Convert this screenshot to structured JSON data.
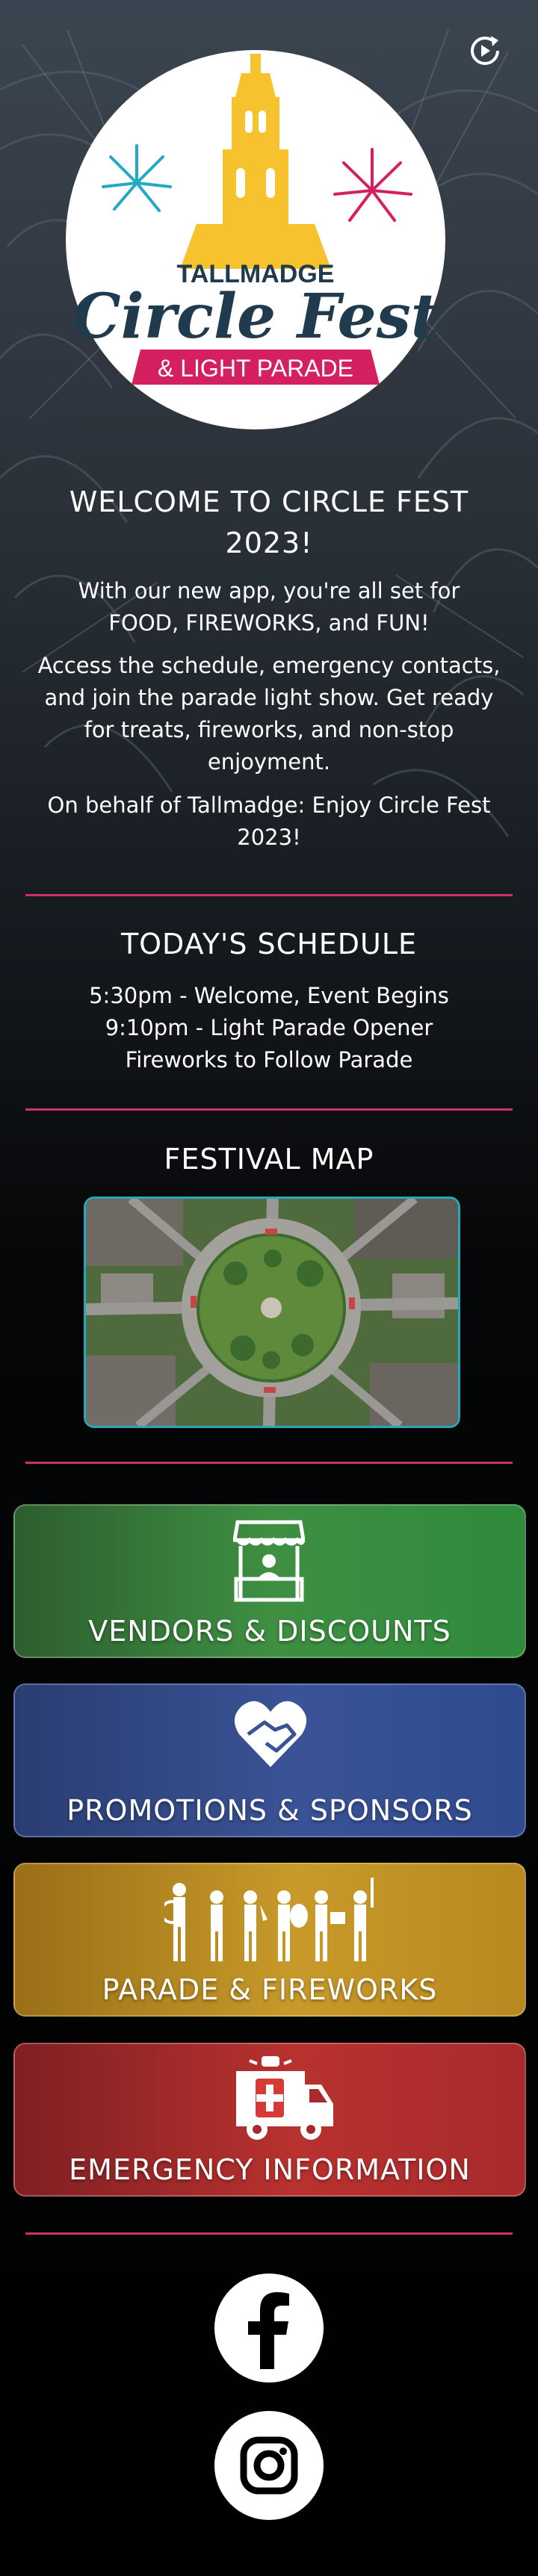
{
  "logo": {
    "top_text": "TALLMADGE",
    "main_text": "Circle Fest",
    "banner_text": "& LIGHT PARADE",
    "colors": {
      "gold": "#f6c22d",
      "navy": "#1f3b4d",
      "magenta": "#d4205f",
      "teal": "#21a9c6"
    }
  },
  "welcome": {
    "title_line1": "WELCOME TO CIRCLE FEST",
    "title_line2": "2023!",
    "p1_line1": "With our new app, you're all set for",
    "p1_line2": "FOOD, FIREWORKS, and FUN!",
    "p2_line1": "Access the schedule, emergency contacts,",
    "p2_line2": "and join the parade light show. Get ready",
    "p2_line3": "for treats, fireworks, and non-stop",
    "p2_line4": "enjoyment.",
    "p3_line1": "On behalf of Tallmadge: Enjoy Circle Fest",
    "p3_line2": "2023!"
  },
  "schedule": {
    "title": "TODAY'S SCHEDULE",
    "items": [
      "5:30pm - Welcome, Event Begins",
      "9:10pm - Light Parade Opener",
      "Fireworks to Follow Parade"
    ]
  },
  "map": {
    "title": "FESTIVAL MAP"
  },
  "tiles": [
    {
      "label": "VENDORS & DISCOUNTS",
      "icon": "vendor-stand-icon",
      "color": "#2f8a3c"
    },
    {
      "label": "PROMOTIONS & SPONSORS",
      "icon": "heart-handshake-icon",
      "color": "#2f4a8f"
    },
    {
      "label": "PARADE & FIREWORKS",
      "icon": "marching-band-icon",
      "color": "#b8891f"
    },
    {
      "label": "EMERGENCY INFORMATION",
      "icon": "ambulance-icon",
      "color": "#a82a2c"
    }
  ],
  "social": [
    {
      "icon": "facebook-icon"
    },
    {
      "icon": "instagram-icon"
    }
  ],
  "colors": {
    "divider": "#c8355e",
    "map_border": "#28a7b8"
  }
}
